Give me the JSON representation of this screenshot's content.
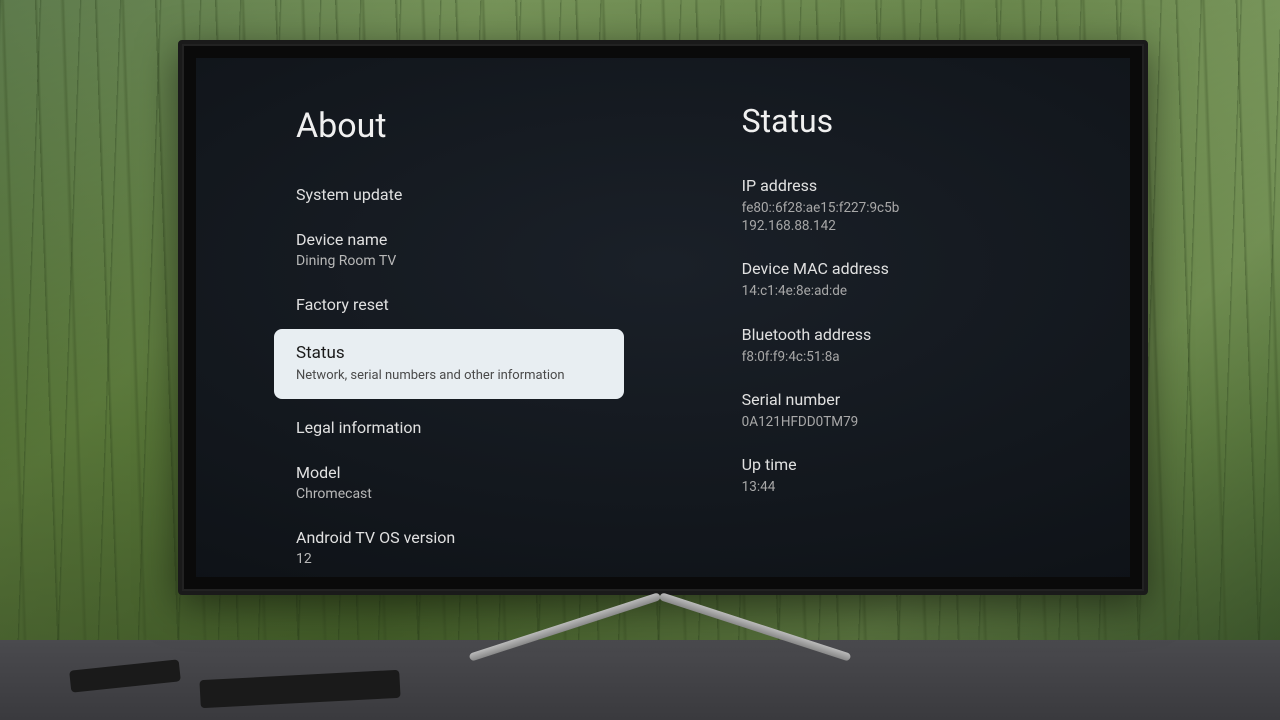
{
  "left": {
    "title": "About",
    "items": [
      {
        "title": "System update",
        "sub": ""
      },
      {
        "title": "Device name",
        "sub": "Dining Room TV"
      },
      {
        "title": "Factory reset",
        "sub": ""
      },
      {
        "title": "Status",
        "sub": "Network, serial numbers and other information"
      },
      {
        "title": "Legal information",
        "sub": ""
      },
      {
        "title": "Model",
        "sub": "Chromecast"
      },
      {
        "title": "Android TV OS version",
        "sub": "12"
      }
    ],
    "selected_index": 3
  },
  "right": {
    "title": "Status",
    "details": [
      {
        "label": "IP address",
        "value": "fe80::6f28:ae15:f227:9c5b\n192.168.88.142"
      },
      {
        "label": "Device MAC address",
        "value": "14:c1:4e:8e:ad:de"
      },
      {
        "label": "Bluetooth address",
        "value": "f8:0f:f9:4c:51:8a"
      },
      {
        "label": "Serial number",
        "value": "0A121HFDD0TM79"
      },
      {
        "label": "Up time",
        "value": "13:44"
      }
    ]
  }
}
